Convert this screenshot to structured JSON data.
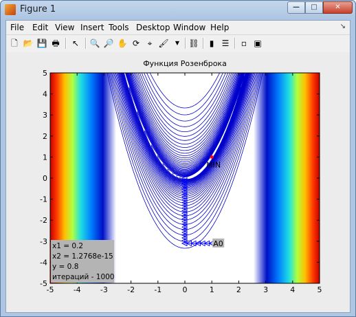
{
  "window": {
    "title": "Figure 1",
    "minimize": "—",
    "maximize": "□",
    "close": "✕"
  },
  "menu": [
    "File",
    "Edit",
    "View",
    "Insert",
    "Tools",
    "Desktop",
    "Window",
    "Help"
  ],
  "toolbar": [
    {
      "name": "new-figure-icon",
      "glyph": "🗋"
    },
    {
      "name": "open-file-icon",
      "glyph": "📂"
    },
    {
      "name": "save-icon",
      "glyph": "💾"
    },
    {
      "name": "print-icon",
      "glyph": "🖶"
    },
    {
      "name": "edit-plot-arrow-icon",
      "glyph": "↖"
    },
    {
      "name": "zoom-in-icon",
      "glyph": "🔍"
    },
    {
      "name": "zoom-out-icon",
      "glyph": "🔎"
    },
    {
      "name": "pan-hand-icon",
      "glyph": "✋"
    },
    {
      "name": "rotate-3d-icon",
      "glyph": "⟳"
    },
    {
      "name": "data-cursor-icon",
      "glyph": "⌖"
    },
    {
      "name": "brush-icon",
      "glyph": "🖌"
    },
    {
      "name": "link-plot-icon",
      "glyph": "⛓"
    },
    {
      "name": "colorbar-icon",
      "glyph": "▮"
    },
    {
      "name": "legend-icon",
      "glyph": "☰"
    },
    {
      "name": "hide-plot-tools-icon",
      "glyph": "▫"
    },
    {
      "name": "show-plot-tools-icon",
      "glyph": "▣"
    }
  ],
  "plot": {
    "title": "Функция Розенброка",
    "xlim": [
      -5,
      5
    ],
    "ylim": [
      -5,
      5
    ],
    "xticks": [
      "-5",
      "-4",
      "-3",
      "-2",
      "-1",
      "0",
      "1",
      "2",
      "3",
      "4",
      "5"
    ],
    "yticks": [
      "5",
      "4",
      "3",
      "2",
      "1",
      "0",
      "-1",
      "-2",
      "-3",
      "-4",
      "-5"
    ],
    "min_label": "MIN",
    "start_label": "A0",
    "info_lines": [
      "x1 = 0.2",
      "x2 = 1.2768e-15",
      "y = 0.8",
      "итераций - 1000"
    ],
    "colors": {
      "contour": "#0000cc",
      "marker": "#ff0000",
      "path": "#0000ff"
    }
  },
  "chart_data": {
    "type": "contour",
    "title": "Функция Розенброка",
    "xlabel": "",
    "ylabel": "",
    "xlim": [
      -5,
      5
    ],
    "ylim": [
      -5,
      5
    ],
    "minimum_point": {
      "x": 1,
      "y": 1,
      "label": "MIN"
    },
    "start_point": {
      "x": 1,
      "y": -3.1,
      "label": "A0"
    },
    "path": [
      [
        1,
        -3.1
      ],
      [
        0,
        -3.1
      ],
      [
        0,
        0
      ]
    ]
  }
}
